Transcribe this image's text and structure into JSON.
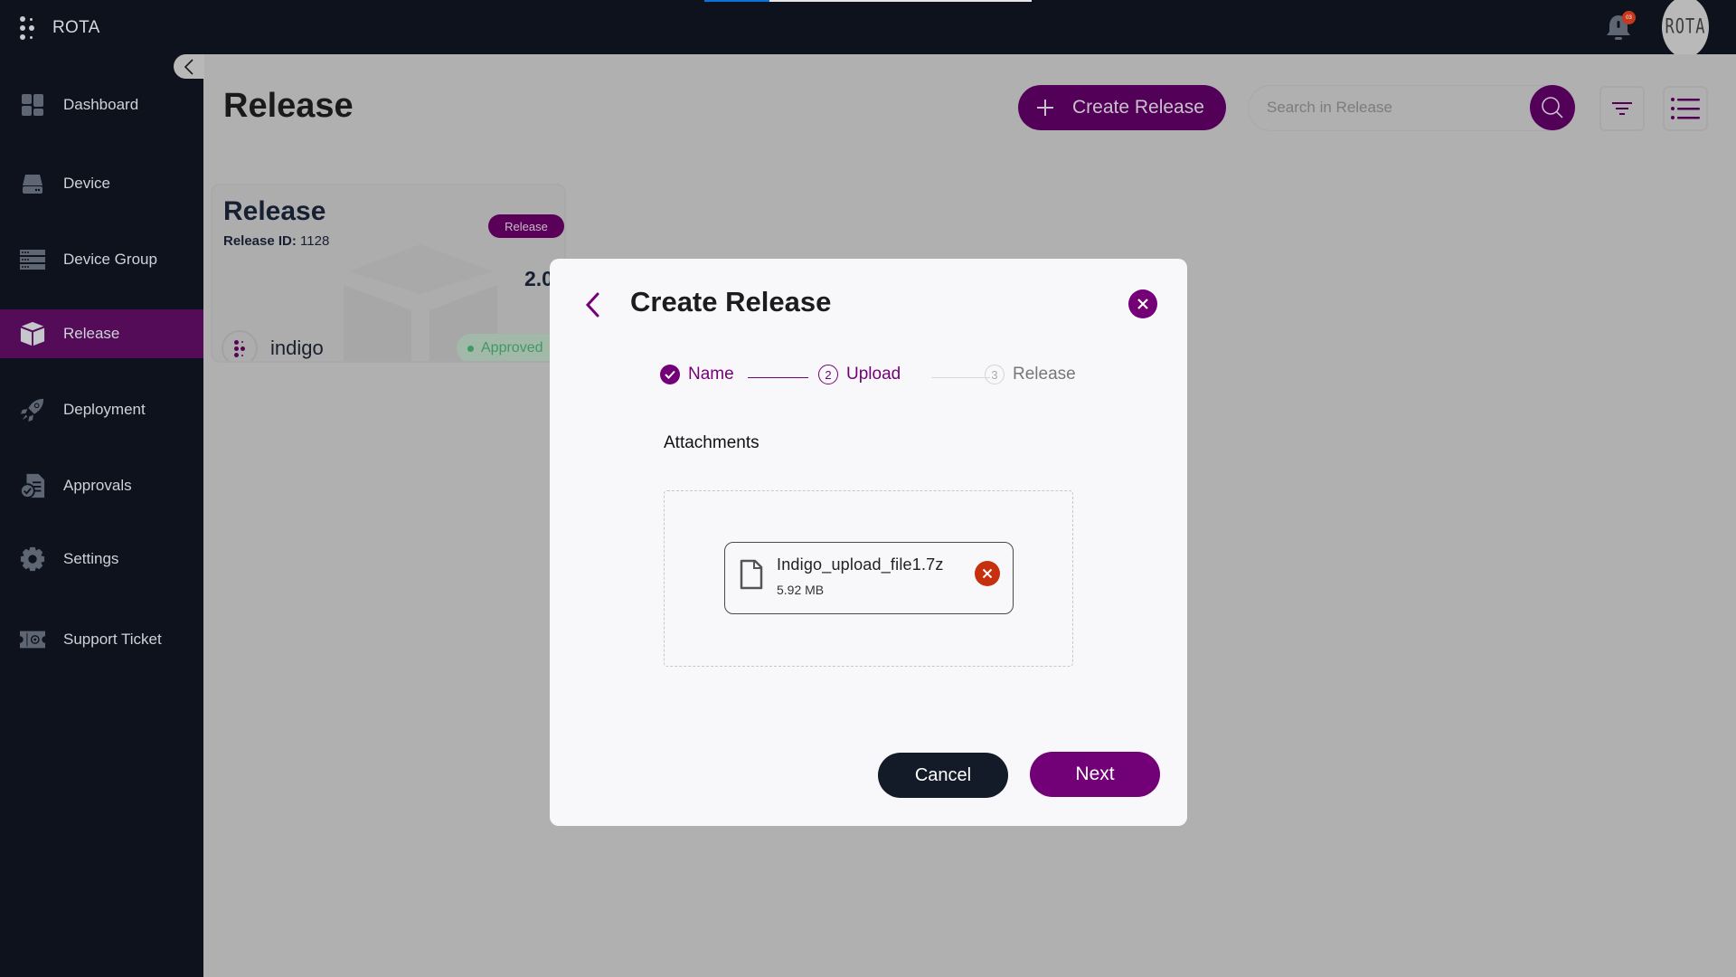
{
  "app": {
    "name": "ROTA",
    "loading_progress_percent": 20,
    "notification_count": "03",
    "avatar_text": "ROTA"
  },
  "sidebar": {
    "items": [
      {
        "label": "Dashboard",
        "icon": "dashboard-icon",
        "active": false
      },
      {
        "label": "Device",
        "icon": "device-icon",
        "active": false
      },
      {
        "label": "Device Group",
        "icon": "device-group-icon",
        "active": false
      },
      {
        "label": "Release",
        "icon": "release-box-icon",
        "active": true
      },
      {
        "label": "Deployment",
        "icon": "rocket-icon",
        "active": false
      },
      {
        "label": "Approvals",
        "icon": "approvals-document-icon",
        "active": false
      },
      {
        "label": "Settings",
        "icon": "gear-icon",
        "active": false
      },
      {
        "label": "Support Ticket",
        "icon": "ticket-icon",
        "active": false
      }
    ]
  },
  "header": {
    "title": "Release",
    "create_button": "Create Release",
    "search_placeholder": "Search in Release"
  },
  "release_card": {
    "title": "Release",
    "id_label": "Release ID:",
    "id_value": "1128",
    "badge": "Release",
    "version": "2.0",
    "organization": "indigo",
    "status": "Approved"
  },
  "modal": {
    "title": "Create Release",
    "steps": [
      {
        "number": "1",
        "label": "Name",
        "state": "completed"
      },
      {
        "number": "2",
        "label": "Upload",
        "state": "active"
      },
      {
        "number": "3",
        "label": "Release",
        "state": "pending"
      }
    ],
    "attachments_label": "Attachments",
    "file": {
      "name": "Indigo_upload_file1.7z",
      "size": "5.92 MB"
    },
    "cancel_label": "Cancel",
    "next_label": "Next"
  },
  "colors": {
    "brand_purple": "#720077",
    "sidebar_active": "#540b58",
    "topbar_bg": "#0e121c",
    "remove_red": "#c6300f",
    "approved_green": "#3e9a62"
  }
}
